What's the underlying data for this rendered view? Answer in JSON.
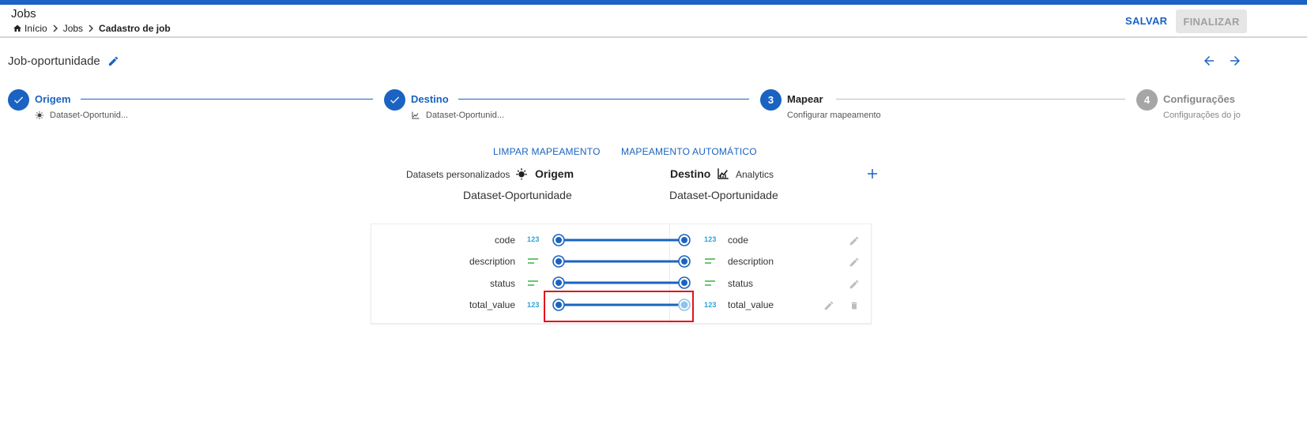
{
  "header": {
    "title": "Jobs",
    "breadcrumb": [
      "Início",
      "Jobs",
      "Cadastro de job"
    ],
    "save_label": "SALVAR",
    "finish_label": "FINALIZAR"
  },
  "job": {
    "name": "Job-oportunidade"
  },
  "steps": [
    {
      "label": "Origem",
      "sub": "Dataset-Oportunid...",
      "state": "done",
      "icon": "bulb-icon"
    },
    {
      "label": "Destino",
      "sub": "Dataset-Oportunid...",
      "state": "done",
      "icon": "chart-icon"
    },
    {
      "number": "3",
      "label": "Mapear",
      "sub": "Configurar mapeamento",
      "state": "current"
    },
    {
      "number": "4",
      "label": "Configurações",
      "sub": "Configurações do jo",
      "state": "pending"
    }
  ],
  "mapping": {
    "clear_label": "LIMPAR MAPEAMENTO",
    "auto_label": "MAPEAMENTO AUTOMÁTICO",
    "source": {
      "category": "Datasets personalizados",
      "title": "Origem",
      "dataset": "Dataset-Oportunidade"
    },
    "target": {
      "title": "Destino",
      "category": "Analytics",
      "dataset": "Dataset-Oportunidade"
    },
    "rows": [
      {
        "source": "code",
        "source_type": "123",
        "target": "code",
        "target_type": "123"
      },
      {
        "source": "description",
        "source_type": "text",
        "target": "description",
        "target_type": "text"
      },
      {
        "source": "status",
        "source_type": "text",
        "target": "status",
        "target_type": "text"
      },
      {
        "source": "total_value",
        "source_type": "123",
        "target": "total_value",
        "target_type": "123"
      }
    ]
  },
  "colors": {
    "primary": "#1a63c2",
    "inactive": "#a6a6a6",
    "text_type": "#3cb043",
    "number_type": "#29a3d6",
    "highlight": "#e0141e"
  }
}
